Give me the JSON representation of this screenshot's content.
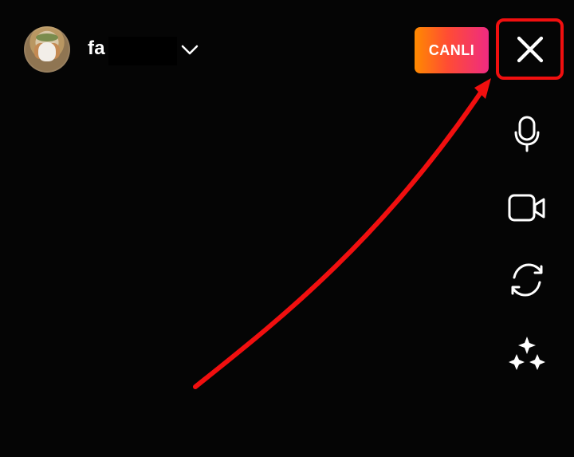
{
  "header": {
    "username": "fa",
    "live_label": "CANLI"
  },
  "icons": {
    "account_chevron": "chevron-down-icon",
    "close": "close-icon",
    "mic": "microphone-icon",
    "video": "video-camera-icon",
    "switch": "switch-camera-icon",
    "effects": "sparkles-effects-icon"
  },
  "colors": {
    "background": "#050505",
    "highlight": "#f10f0f",
    "live_gradient_start": "#ff8a00",
    "live_gradient_end": "#ee2b82"
  }
}
